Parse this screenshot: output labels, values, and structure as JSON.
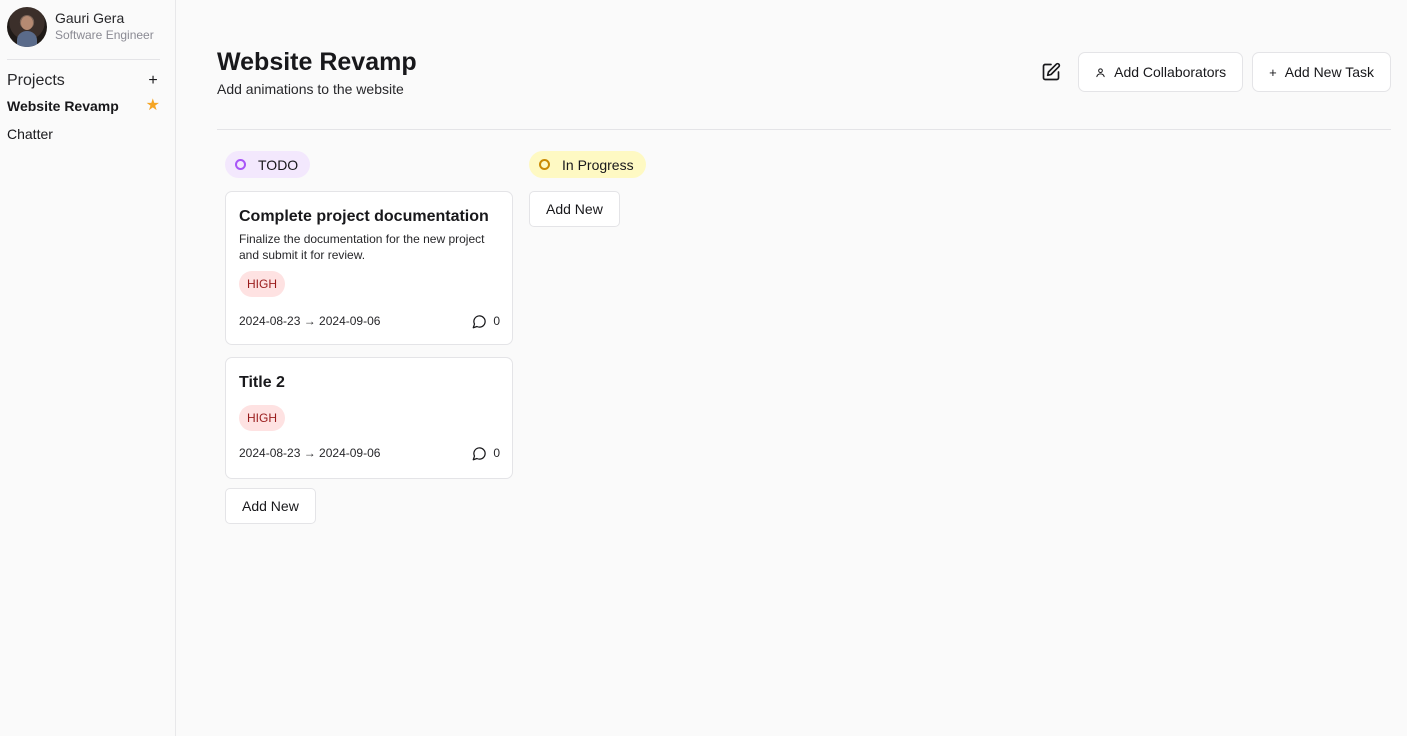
{
  "profile": {
    "name": "Gauri Gera",
    "role": "Software Engineer"
  },
  "sidebar": {
    "projects_label": "Projects",
    "add_icon": "+",
    "items": [
      {
        "label": "Website Revamp",
        "active": true,
        "starred": true
      },
      {
        "label": "Chatter",
        "active": false,
        "starred": false
      }
    ]
  },
  "header": {
    "title": "Website Revamp",
    "subtitle": "Add animations to the website",
    "add_collaborators_label": "Add Collaborators",
    "add_task_label": "Add New Task",
    "add_task_icon": "+"
  },
  "columns": [
    {
      "status": "TODO",
      "color": "#a855f7",
      "cards": [
        {
          "title": "Complete project documentation",
          "description": "Finalize the documentation for the new project and submit it for review.",
          "priority": "HIGH",
          "dates": "2024-08-23 → 2024-09-06",
          "comments": "0"
        },
        {
          "title": "Title 2",
          "description": "",
          "priority": "HIGH",
          "dates": "2024-08-23 → 2024-09-06",
          "comments": "0"
        }
      ],
      "add_new_label": "Add New"
    },
    {
      "status": "In Progress",
      "color": "#ca8a04",
      "cards": [],
      "add_new_label": "Add New"
    }
  ],
  "icons": {
    "star": "star-icon",
    "edit": "edit-icon",
    "user": "user-icon",
    "comment": "comment-icon"
  }
}
